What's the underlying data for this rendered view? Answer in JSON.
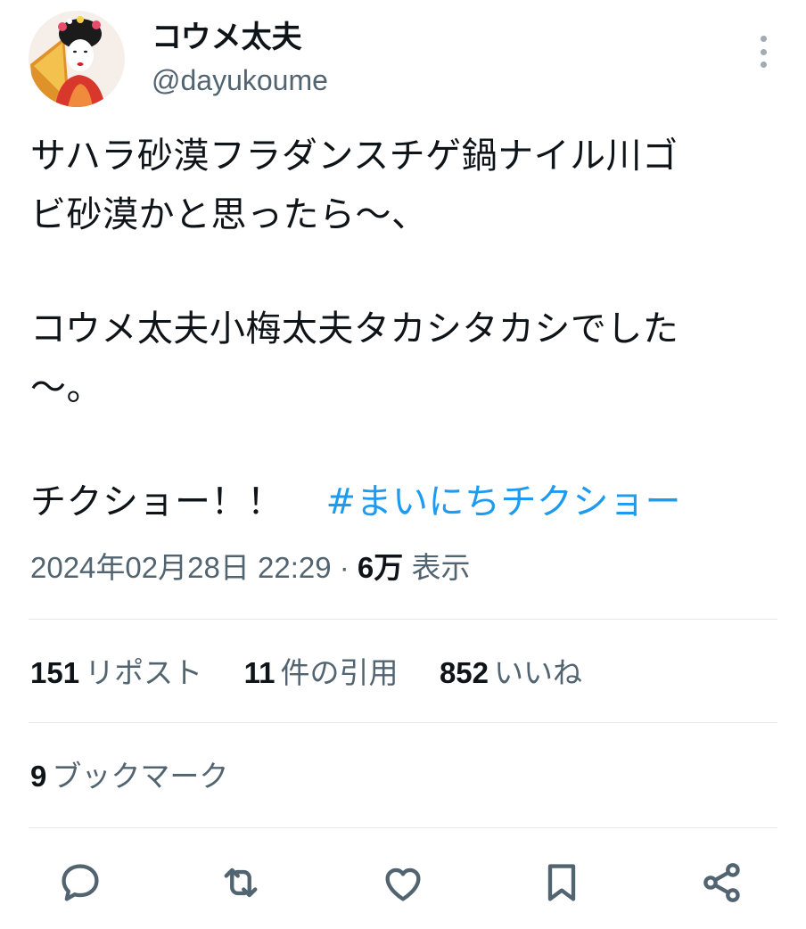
{
  "user": {
    "display_name": "コウメ太夫",
    "handle": "@dayukoume"
  },
  "tweet": {
    "lines_1": [
      "サハラ砂漠フラダンスチゲ鍋ナイル川ゴ",
      "ビ砂漠かと思ったら〜、"
    ],
    "lines_2": [
      "コウメ太夫小梅太夫タカシタカシでした",
      "〜。"
    ],
    "closing": "チクショー！！",
    "hashtag": "#まいにちチクショー"
  },
  "meta": {
    "timestamp": "2024年02月28日 22:29",
    "separator": " · ",
    "views_count": "6万",
    "views_label": "表示"
  },
  "stats": {
    "reposts": {
      "count": "151",
      "label": "リポスト"
    },
    "quotes": {
      "count": "11",
      "label": "件の引用"
    },
    "likes": {
      "count": "852",
      "label": "いいね"
    },
    "bookmarks": {
      "count": "9",
      "label": "ブックマーク"
    }
  },
  "actions": [
    "reply-icon",
    "repost-icon",
    "like-icon",
    "bookmark-icon",
    "share-icon"
  ],
  "colors": {
    "text": "#0f1419",
    "secondary": "#536471",
    "link": "#1d9bf0",
    "divider": "#e4e8ea"
  }
}
